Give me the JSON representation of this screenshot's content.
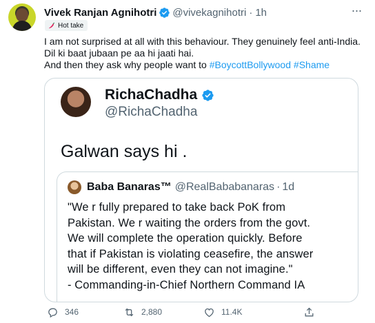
{
  "tweet": {
    "author_name": "Vivek Ranjan Agnihotri",
    "author_handle": "@vivekagnihotri",
    "separator": "·",
    "time": "1h",
    "badge_label": "Hot take",
    "text_lines": [
      "I am not surprised at all with this behaviour. They genuinely feel anti-India.",
      "Dil ki baat jubaan pe aa hi jaati hai."
    ],
    "text_line3_prefix": "And then they ask why people want to ",
    "hashtags": [
      "#BoycottBollywood",
      "#Shame"
    ]
  },
  "quoted": {
    "name": "RichaChadha",
    "handle": "@RichaChadha",
    "text": "Galwan says hi ."
  },
  "inner_quote": {
    "name": "Baba Banaras™",
    "handle": "@RealBababanaras",
    "separator": "·",
    "time": "1d",
    "text_lines": [
      "\"We r fully prepared to take back PoK from",
      "Pakistan. We r waiting the orders from the govt.",
      "We will complete the operation quickly. Before",
      "that if Pakistan is violating ceasefire, the answer",
      "will be different, even they can not imagine.\"",
      "- Commanding-in-Chief Northern Command IA"
    ]
  },
  "actions": {
    "replies": "346",
    "retweets": "2,880",
    "likes": "11.4K"
  },
  "colors": {
    "accent": "#1d9bf0",
    "secondary_text": "#536471",
    "border": "#cfd9de",
    "badge_bg": "#eff3f4"
  },
  "icons": [
    "verified-badge-icon",
    "more-icon",
    "chili-icon",
    "reply-icon",
    "retweet-icon",
    "like-icon",
    "share-icon"
  ]
}
